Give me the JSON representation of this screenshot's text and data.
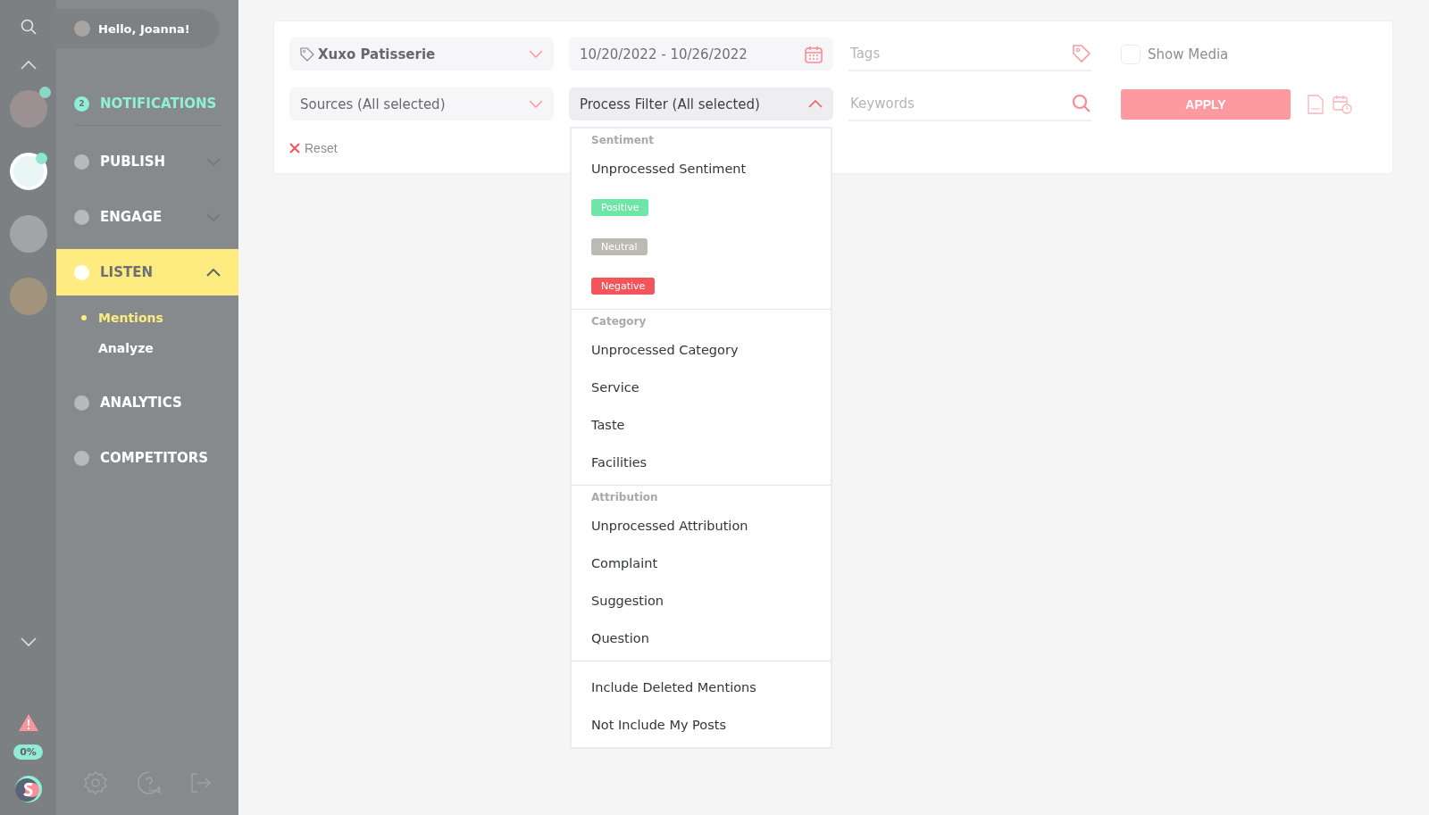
{
  "rail": {
    "brands": [
      {
        "selected": false,
        "badge": true
      },
      {
        "selected": true,
        "badge": true
      },
      {
        "selected": false,
        "badge": false
      },
      {
        "selected": false,
        "badge": false
      }
    ],
    "quota": "0%"
  },
  "sidebar": {
    "greeting": "Hello, Joanna!",
    "items": [
      {
        "label": "NOTIFICATIONS",
        "count": "2",
        "selected": false
      },
      {
        "label": "PUBLISH",
        "expanded": false,
        "selected": false
      },
      {
        "label": "ENGAGE",
        "expanded": false,
        "selected": false
      },
      {
        "label": "LISTEN",
        "expanded": true,
        "selected": true,
        "children": [
          {
            "label": "Mentions",
            "selected": true
          },
          {
            "label": "Analyze",
            "selected": false
          }
        ]
      },
      {
        "label": "ANALYTICS",
        "selected": false
      },
      {
        "label": "COMPETITORS",
        "selected": false
      }
    ]
  },
  "filters": {
    "brand": {
      "value": "Xuxo Patisserie"
    },
    "date_range": {
      "value": "10/20/2022 - 10/26/2022"
    },
    "tags": {
      "placeholder": "Tags"
    },
    "show_media": {
      "label": "Show Media",
      "checked": false
    },
    "sources": {
      "value": "Sources (All selected)",
      "expanded": false
    },
    "process_filter": {
      "value": "Process Filter (All selected)",
      "expanded": true
    },
    "keywords": {
      "placeholder": "Keywords"
    },
    "apply": "APPLY",
    "reset": "Reset"
  },
  "process_menu": [
    {
      "header": "Sentiment",
      "options": [
        {
          "kind": "text",
          "label": "Unprocessed Sentiment"
        },
        {
          "kind": "tag",
          "label": "Positive",
          "color": "#6ee7a6"
        },
        {
          "kind": "tag",
          "label": "Neutral",
          "color": "#bdbab3"
        },
        {
          "kind": "tag",
          "label": "Negative",
          "color": "#f4555a"
        }
      ]
    },
    {
      "header": "Category",
      "options": [
        {
          "kind": "text",
          "label": "Unprocessed Category"
        },
        {
          "kind": "text",
          "label": "Service"
        },
        {
          "kind": "text",
          "label": "Taste"
        },
        {
          "kind": "text",
          "label": "Facilities"
        }
      ]
    },
    {
      "header": "Attribution",
      "options": [
        {
          "kind": "text",
          "label": "Unprocessed Attribution"
        },
        {
          "kind": "text",
          "label": "Complaint"
        },
        {
          "kind": "text",
          "label": "Suggestion"
        },
        {
          "kind": "text",
          "label": "Question"
        }
      ]
    },
    {
      "options": [
        {
          "kind": "text",
          "label": "Include Deleted Mentions"
        },
        {
          "kind": "text",
          "label": "Not Include My Posts"
        }
      ]
    }
  ]
}
